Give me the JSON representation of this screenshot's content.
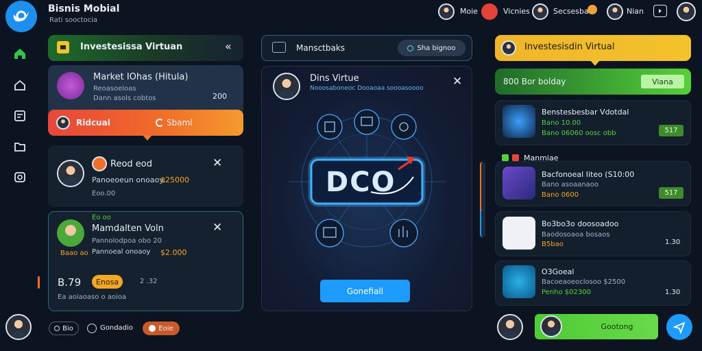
{
  "header": {
    "app_title": "Bisnis Mobial",
    "app_subtitle": "Rati sooctocia",
    "users": [
      {
        "name": "Moie"
      },
      {
        "name": "Vicnies"
      },
      {
        "name": "Secsesbar"
      },
      {
        "name": "Nian"
      }
    ]
  },
  "left_panel": {
    "title": "Investesissa Virtuan",
    "collapse_glyph": "«",
    "market_card": {
      "title": "Market IOhas (Hitula)",
      "line1": "Reoasoeloas",
      "line2": "Dann asols cobtos",
      "value": "200"
    },
    "orange_bar": {
      "left": "Ridcual",
      "right": "Sbaml"
    },
    "item1": {
      "title": "Reod eod",
      "desc": "Panoeoeun onoaoy:",
      "amount": "$25000",
      "sub": "Eoo.00"
    },
    "item2": {
      "tag": "Eo oo",
      "title": "Mamdalten Voln",
      "line1": "Pannolodpoa obo 20",
      "line2": "Pannoeal onoaoy",
      "amount": "$2.000",
      "sub": "Baao ao"
    },
    "bottom": {
      "value": "B.79",
      "badge": "Enosa",
      "num": "2 .32",
      "sub": "Ea aoiaoaso o aoioa"
    }
  },
  "bottom_bar": {
    "chip1": "Bio",
    "chip2": "Gondadio",
    "chip3": "Eoie"
  },
  "center": {
    "top_label": "Mansctbaks",
    "top_chip": "Sha bignoo",
    "modal_title": "Dins Virtue",
    "modal_sub": "Nooosaboneoc Dooaoaa soooasoooo",
    "logo_text": "DCO",
    "confirm_label": "Gonefiall"
  },
  "right_panel": {
    "banner_title": "Investesisdin Virtual",
    "green_bar": {
      "text": "800 Bor bolday",
      "button": "Viana"
    },
    "cards": [
      {
        "title": "Benstesbesbar Vdotdal",
        "line1": "Bano 10.00",
        "line2": "Bano 06060 oosc obb",
        "value": "517"
      },
      {
        "title": "Bacfonoeal Iiteo (S10:00",
        "line1": "Bano asoaanaoo",
        "line2": "Bano 0600",
        "value": "517"
      },
      {
        "title": "Bo3bo3o doosoadoo",
        "line1": "Baodosoaoa bosaos",
        "line2": "B5bao",
        "value": "1.30"
      },
      {
        "title": "O3Goeal",
        "line1": "Bacoeaoeoclosoo $2500",
        "line2": "Penho $02300",
        "value": "1.30"
      }
    ],
    "section_label": "Manmiae",
    "action_button": "Gootong"
  },
  "colors": {
    "accent_blue": "#1e9bff",
    "green": "#56d13a",
    "orange": "#f0702a",
    "yellow": "#f3c22c"
  }
}
